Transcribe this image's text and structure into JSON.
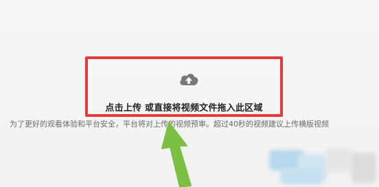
{
  "upload": {
    "label": "点击上传 或直接将视频文件拖入此区域",
    "icon": "cloud-upload-icon"
  },
  "notice": {
    "text": "为了更好的观看体验和平台安全，平台将对上传的视频预审。超过40秒的视频建议上传横版视频"
  },
  "colors": {
    "highlight_border": "#e53a3a",
    "arrow": "#7cc043",
    "icon": "#777777"
  }
}
